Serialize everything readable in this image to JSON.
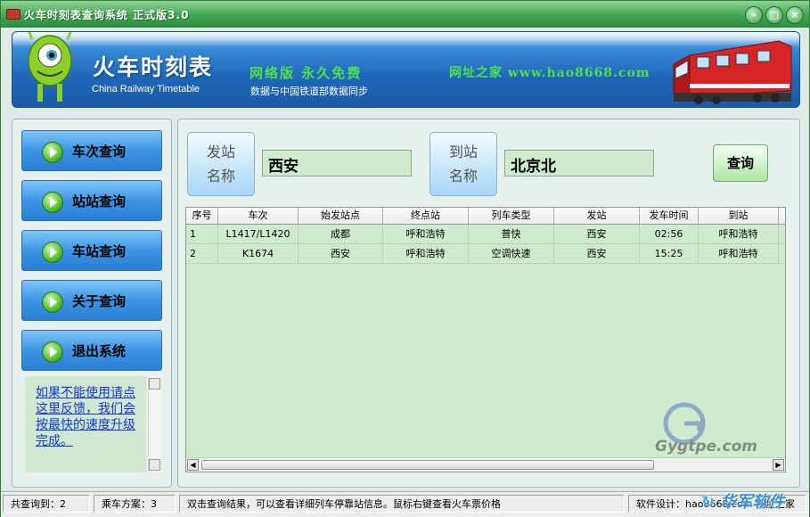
{
  "window": {
    "title": "火车时刻表查询系统  正式版3.0",
    "controls": [
      "minimize-icon",
      "maximize-icon",
      "close-icon"
    ]
  },
  "banner": {
    "title": "火车时刻表",
    "subtitle": "China Railway Timetable",
    "slogan": "网络版  永久免费",
    "sync_note": "数据与中国铁道部数据同步",
    "site": "网址之家  www.hao8668.com"
  },
  "sidebar": {
    "items": [
      {
        "label": "车次查询",
        "icon": "play-icon"
      },
      {
        "label": "站站查询",
        "icon": "play-icon"
      },
      {
        "label": "车站查询",
        "icon": "play-icon"
      },
      {
        "label": "关于查询",
        "icon": "play-icon"
      },
      {
        "label": "退出系统",
        "icon": "play-icon"
      }
    ],
    "feedback_link": "如果不能使用请点这里反馈，我们会按最快的速度升级完成。"
  },
  "search": {
    "from_label_line1": "发站",
    "from_label_line2": "名称",
    "from_value": "西安",
    "to_label_line1": "到站",
    "to_label_line2": "名称",
    "to_value": "北京北",
    "query_label": "查询"
  },
  "table": {
    "columns": [
      "序号",
      "车次",
      "始发站点",
      "终点站",
      "列车类型",
      "发站",
      "发车时间",
      "到站"
    ],
    "rows": [
      [
        "1",
        "L1417/L1420",
        "成都",
        "呼和浩特",
        "普快",
        "西安",
        "02:56",
        "呼和浩特"
      ],
      [
        "2",
        "K1674",
        "西安",
        "呼和浩特",
        "空调快速",
        "西安",
        "15:25",
        "呼和浩特"
      ]
    ]
  },
  "status": {
    "total": "共查询到：2",
    "plans": "乘车方案：3",
    "hint": "双击查询结果，可以查看详细列车停靠站信息。鼠标右键查看火车票价格",
    "designer": "软件设计：hao8668.com  网址之家"
  },
  "watermark": {
    "logo_text": "Gygtpe.com",
    "brand": "华军软件"
  },
  "colors": {
    "title_bar": "#3fa650",
    "banner_blue": "#1f67b9",
    "slogan_green": "#4ee04e",
    "grid_bg": "#cdeccd",
    "link_blue": "#1638d8"
  }
}
